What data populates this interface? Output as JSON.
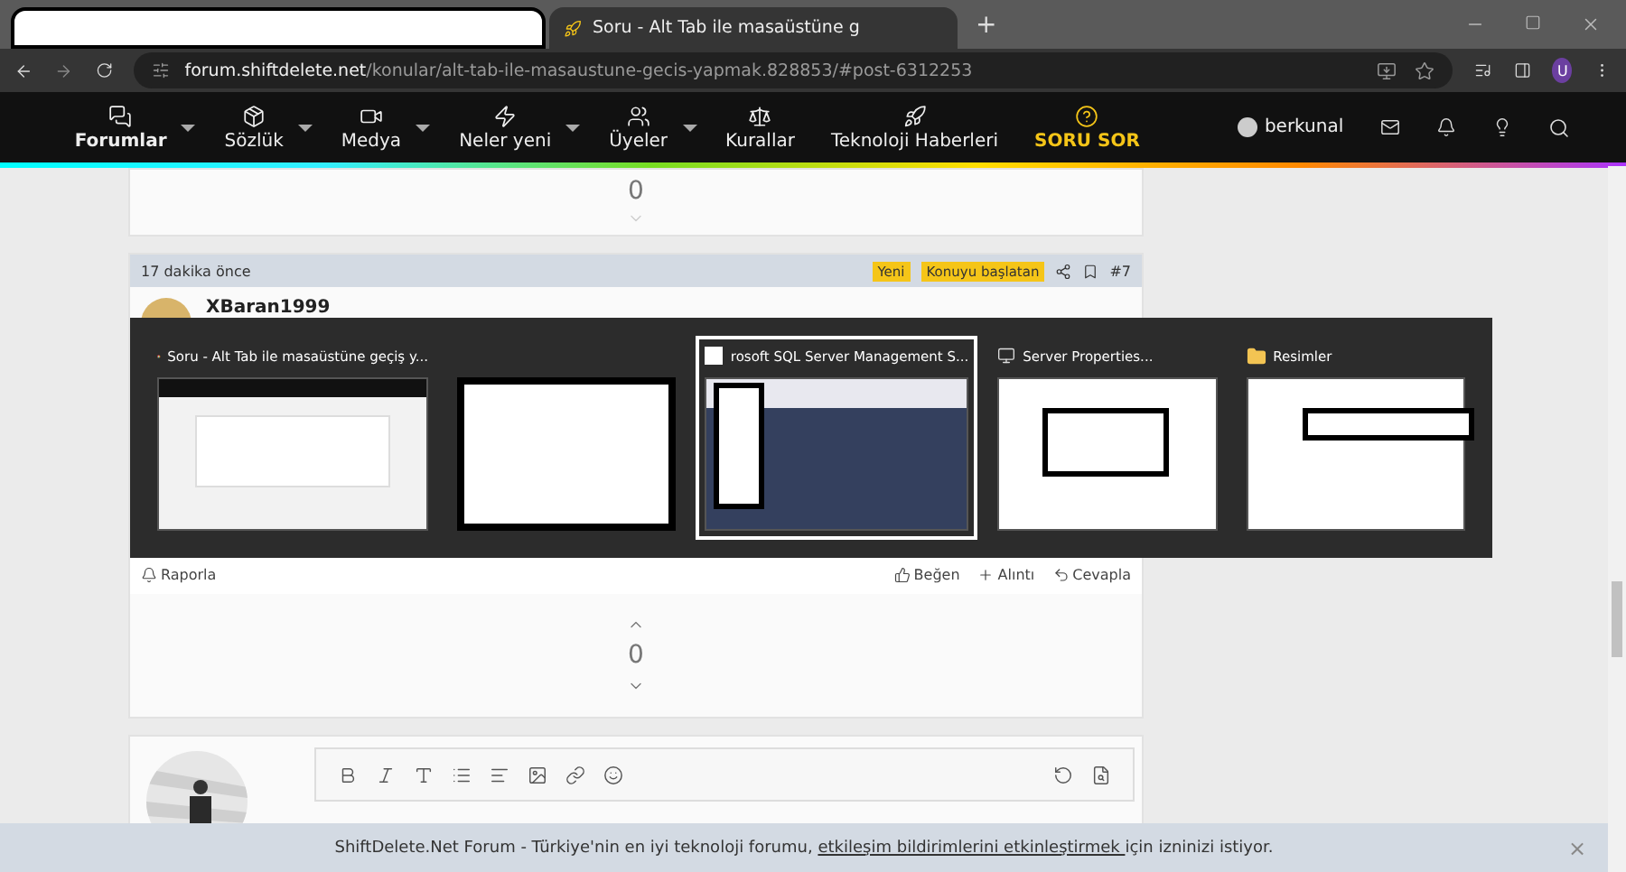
{
  "browser": {
    "tabs": [
      {
        "kind": "redacted",
        "selected": false
      },
      {
        "kind": "page",
        "title": "Soru - Alt Tab ile masaüstüne g",
        "selected": true
      }
    ],
    "new_tab": "+",
    "url_host": "forum.shiftdelete.net",
    "url_path": "/konular/alt-tab-ile-masaustune-gecis-yapmak.828853/#post-6312253",
    "profile": "U"
  },
  "nav": {
    "items": [
      {
        "label": "Forumlar",
        "caret": true,
        "active": true
      },
      {
        "label": "Sözlük",
        "caret": true,
        "active": false
      },
      {
        "label": "Medya",
        "caret": true,
        "active": false
      },
      {
        "label": "Neler yeni",
        "caret": true,
        "active": false
      },
      {
        "label": "Üyeler",
        "caret": true,
        "active": false
      },
      {
        "label": "Kurallar",
        "caret": false,
        "active": false
      },
      {
        "label": "Teknoloji Haberleri",
        "caret": false,
        "active": false
      },
      {
        "label": "SORU SOR",
        "caret": false,
        "active": false,
        "highlight": true
      }
    ],
    "user": "berkunal"
  },
  "prev_vote": {
    "count": "0"
  },
  "post": {
    "time": "17 dakika önce",
    "badges": [
      "Yeni",
      "Konuyu başlatan"
    ],
    "number": "#7",
    "author": "XBaran1999",
    "actions_left": "Raporla",
    "actions": [
      {
        "label": "Beğen"
      },
      {
        "label": "Alıntı"
      },
      {
        "label": "Cevapla"
      }
    ]
  },
  "vote": {
    "count": "0"
  },
  "notice": {
    "text_before": "ShiftDelete.Net Forum - Türkiye'nin en iyi teknoloji forumu, ",
    "link": "etkileşim bildirimlerini etkinleştirmek ",
    "text_after": "için izninizi istiyor.",
    "close": "×"
  },
  "alt_tab": {
    "windows": [
      {
        "kind": "chrome",
        "title": "Soru - Alt Tab ile masaüstüne geçiş y...",
        "selected": false
      },
      {
        "kind": "redacted",
        "selected": false
      },
      {
        "kind": "ssms",
        "title": "rosoft SQL Server Management S...",
        "selected": true
      },
      {
        "kind": "dialog",
        "title": "Server Properties...",
        "selected": false
      },
      {
        "kind": "folder",
        "title": "Resimler",
        "selected": false
      }
    ]
  }
}
